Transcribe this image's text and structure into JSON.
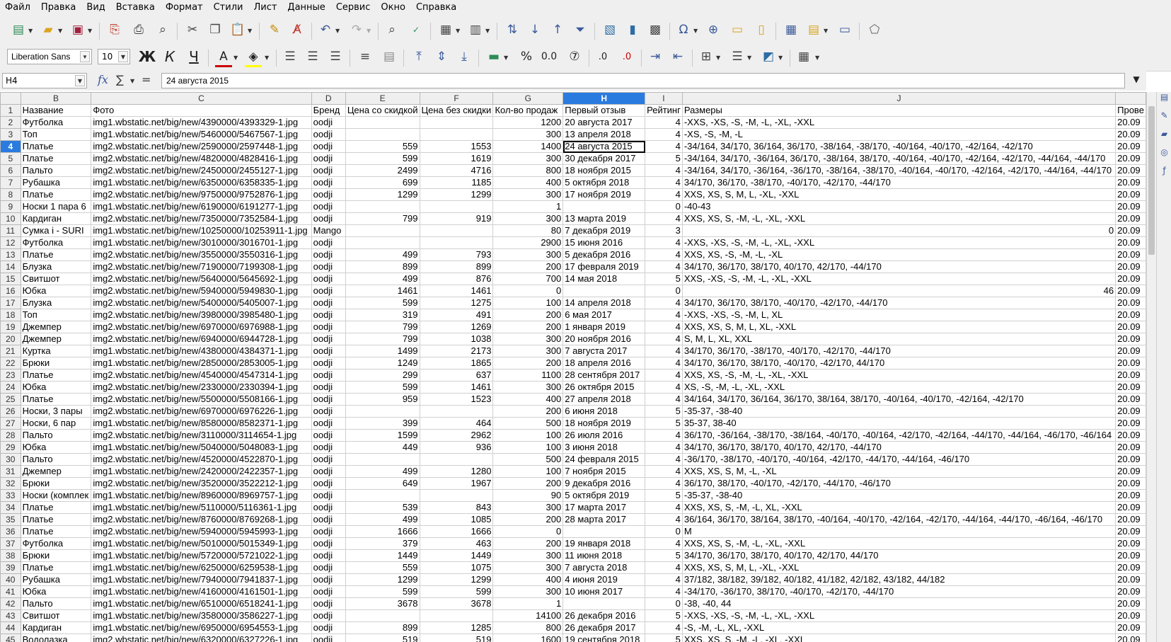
{
  "menu": [
    "Файл",
    "Правка",
    "Вид",
    "Вставка",
    "Формат",
    "Стили",
    "Лист",
    "Данные",
    "Сервис",
    "Окно",
    "Справка"
  ],
  "toolbar": {
    "font_name": "Liberation Sans",
    "font_size": "10",
    "bold": "Ж",
    "italic": "К",
    "underline": "Ч",
    "percent": "%",
    "decimal": "0.0",
    "add_decimal": ".0",
    "del_decimal": ".0"
  },
  "formula_bar": {
    "cell_ref": "H4",
    "fx": "fx",
    "sum": "∑",
    "eq": "=",
    "content": "24 августа 2015"
  },
  "columns": [
    "B",
    "C",
    "D",
    "E",
    "F",
    "G",
    "H",
    "I",
    "J"
  ],
  "selected_column": "H",
  "selected_row": 4,
  "header_row": [
    "Название",
    "Фото",
    "Бренд",
    "Цена со скидкой",
    "Цена без скидки",
    "Кол-во продаж",
    "Первый отзыв",
    "Рейтинг",
    "Размеры",
    "Прове"
  ],
  "rows": [
    [
      "Футболка",
      "img1.wbstatic.net/big/new/4390000/4393329-1.jpg",
      "oodji",
      "",
      "",
      "1200",
      "20 августа 2017",
      "4",
      "-XXS, -XS, -S, -M, -L, -XL, -XXL",
      "20.09"
    ],
    [
      "Топ",
      "img1.wbstatic.net/big/new/5460000/5467567-1.jpg",
      "oodji",
      "",
      "",
      "300",
      "13 апреля 2018",
      "4",
      "-XS, -S, -M, -L",
      "20.09"
    ],
    [
      "Платье",
      "img2.wbstatic.net/big/new/2590000/2597448-1.jpg",
      "oodji",
      "559",
      "1553",
      "1400",
      "24 августа 2015",
      "4",
      "-34/164, 34/170, 36/164, 36/170, -38/164, -38/170, -40/164, -40/170, -42/164, -42/170",
      "20.09"
    ],
    [
      "Платье",
      "img2.wbstatic.net/big/new/4820000/4828416-1.jpg",
      "oodji",
      "599",
      "1619",
      "300",
      "30 декабря 2017",
      "5",
      "-34/164, 34/170, -36/164, 36/170, -38/164, 38/170, -40/164, -40/170, -42/164, -42/170, -44/164, -44/170",
      "20.09"
    ],
    [
      "Пальто",
      "img2.wbstatic.net/big/new/2450000/2455127-1.jpg",
      "oodji",
      "2499",
      "4716",
      "800",
      "18 ноября 2015",
      "4",
      "-34/164, 34/170, -36/164, -36/170, -38/164, -38/170, -40/164, -40/170, -42/164, -42/170, -44/164, -44/170",
      "20.09"
    ],
    [
      "Рубашка",
      "img1.wbstatic.net/big/new/6350000/6358335-1.jpg",
      "oodji",
      "699",
      "1185",
      "400",
      "5 октября 2018",
      "4",
      "34/170, 36/170, -38/170, -40/170, -42/170, -44/170",
      "20.09"
    ],
    [
      "Платье",
      "img2.wbstatic.net/big/new/9750000/9752876-1.jpg",
      "oodji",
      "1299",
      "1299",
      "300",
      "17 ноября 2019",
      "4",
      "XXS, XS, S, M, L, -XL, -XXL",
      "20.09"
    ],
    [
      "Носки 1 пара 6",
      "img1.wbstatic.net/big/new/6190000/6191277-1.jpg",
      "oodji",
      "",
      "",
      "1",
      "",
      "0",
      "-40-43",
      "20.09"
    ],
    [
      "Кардиган",
      "img2.wbstatic.net/big/new/7350000/7352584-1.jpg",
      "oodji",
      "799",
      "919",
      "300",
      "13 марта 2019",
      "4",
      "XXS, XS, S, -M, -L, -XL, -XXL",
      "20.09"
    ],
    [
      "Сумка i - SURI",
      "img1.wbstatic.net/big/new/10250000/10253911-1.jpg",
      "Mango",
      "",
      "",
      "80",
      "7 декабря 2019",
      "3",
      "0",
      "20.09"
    ],
    [
      "Футболка",
      "img1.wbstatic.net/big/new/3010000/3016701-1.jpg",
      "oodji",
      "",
      "",
      "2900",
      "15 июня 2016",
      "4",
      "-XXS, -XS, -S, -M, -L, -XL, -XXL",
      "20.09"
    ],
    [
      "Платье",
      "img2.wbstatic.net/big/new/3550000/3550316-1.jpg",
      "oodji",
      "499",
      "793",
      "300",
      "5 декабря 2016",
      "4",
      "XXS, XS, -S, -M, -L, -XL",
      "20.09"
    ],
    [
      "Блузка",
      "img2.wbstatic.net/big/new/7190000/7199308-1.jpg",
      "oodji",
      "899",
      "899",
      "200",
      "17 февраля 2019",
      "4",
      "34/170, 36/170, 38/170, 40/170, 42/170, -44/170",
      "20.09"
    ],
    [
      "Свитшот",
      "img2.wbstatic.net/big/new/5640000/5645692-1.jpg",
      "oodji",
      "499",
      "876",
      "700",
      "14 мая 2018",
      "5",
      "XXS, -XS, -S, -M, -L, -XL, -XXL",
      "20.09"
    ],
    [
      "Юбка",
      "img2.wbstatic.net/big/new/5940000/5949830-1.jpg",
      "oodji",
      "1461",
      "1461",
      "0",
      "",
      "0",
      "46",
      "20.09"
    ],
    [
      "Блузка",
      "img2.wbstatic.net/big/new/5400000/5405007-1.jpg",
      "oodji",
      "599",
      "1275",
      "100",
      "14 апреля 2018",
      "4",
      "34/170, 36/170, 38/170, -40/170, -42/170, -44/170",
      "20.09"
    ],
    [
      "Топ",
      "img2.wbstatic.net/big/new/3980000/3985480-1.jpg",
      "oodji",
      "319",
      "491",
      "200",
      "6 мая 2017",
      "4",
      "-XXS, -XS, -S, -M, L, XL",
      "20.09"
    ],
    [
      "Джемпер",
      "img2.wbstatic.net/big/new/6970000/6976988-1.jpg",
      "oodji",
      "799",
      "1269",
      "200",
      "1 января 2019",
      "4",
      "XXS, XS, S, M, L, XL, -XXL",
      "20.09"
    ],
    [
      "Джемпер",
      "img2.wbstatic.net/big/new/6940000/6944728-1.jpg",
      "oodji",
      "799",
      "1038",
      "300",
      "20 ноября 2016",
      "4",
      "S, M, L, XL, XXL",
      "20.09"
    ],
    [
      "Куртка",
      "img1.wbstatic.net/big/new/4380000/4384371-1.jpg",
      "oodji",
      "1499",
      "2173",
      "300",
      "7 августа 2017",
      "4",
      "34/170, 36/170, -38/170, -40/170, -42/170, -44/170",
      "20.09"
    ],
    [
      "Брюки",
      "img1.wbstatic.net/big/new/2850000/2853005-1.jpg",
      "oodji",
      "1249",
      "1865",
      "200",
      "18 апреля 2016",
      "4",
      "34/170, 36/170, 38/170, -40/170, -42/170, 44/170",
      "20.09"
    ],
    [
      "Платье",
      "img2.wbstatic.net/big/new/4540000/4547314-1.jpg",
      "oodji",
      "299",
      "637",
      "1100",
      "28 сентября 2017",
      "4",
      "XXS, XS, -S, -M, -L, -XL, -XXL",
      "20.09"
    ],
    [
      "Юбка",
      "img2.wbstatic.net/big/new/2330000/2330394-1.jpg",
      "oodji",
      "599",
      "1461",
      "300",
      "26 октября 2015",
      "4",
      "XS, -S, -M, -L, -XL, -XXL",
      "20.09"
    ],
    [
      "Платье",
      "img2.wbstatic.net/big/new/5500000/5508166-1.jpg",
      "oodji",
      "959",
      "1523",
      "400",
      "27 апреля 2018",
      "4",
      "34/164, 34/170, 36/164, 36/170, 38/164, 38/170, -40/164, -40/170, -42/164, -42/170",
      "20.09"
    ],
    [
      "Носки, 3 пары",
      "img2.wbstatic.net/big/new/6970000/6976226-1.jpg",
      "oodji",
      "",
      "",
      "200",
      "6 июня 2018",
      "5",
      "-35-37, -38-40",
      "20.09"
    ],
    [
      "Носки, 6 пар",
      "img1.wbstatic.net/big/new/8580000/8582371-1.jpg",
      "oodji",
      "399",
      "464",
      "500",
      "18 ноября 2019",
      "5",
      "35-37, 38-40",
      "20.09"
    ],
    [
      "Пальто",
      "img2.wbstatic.net/big/new/3110000/3114654-1.jpg",
      "oodji",
      "1599",
      "2962",
      "100",
      "26 июля 2016",
      "4",
      "36/170, -36/164, -38/170, -38/164, -40/170, -40/164, -42/170, -42/164, -44/170, -44/164, -46/170, -46/164",
      "20.09"
    ],
    [
      "Юбка",
      "img1.wbstatic.net/big/new/5040000/5048083-1.jpg",
      "oodji",
      "449",
      "936",
      "100",
      "3 июня 2018",
      "4",
      "34/170, 36/170, 38/170, 40/170, 42/170, -44/170",
      "20.09"
    ],
    [
      "Пальто",
      "img2.wbstatic.net/big/new/4520000/4522870-1.jpg",
      "oodji",
      "",
      "",
      "500",
      "24 февраля 2015",
      "4",
      "-36/170, -38/170, -40/170, -40/164, -42/170, -44/170, -44/164, -46/170",
      "20.09"
    ],
    [
      "Джемпер",
      "img1.wbstatic.net/big/new/2420000/2422357-1.jpg",
      "oodji",
      "499",
      "1280",
      "100",
      "7 ноября 2015",
      "4",
      "XXS, XS, S, M, -L, -XL",
      "20.09"
    ],
    [
      "Брюки",
      "img2.wbstatic.net/big/new/3520000/3522212-1.jpg",
      "oodji",
      "649",
      "1967",
      "200",
      "9 декабря 2016",
      "4",
      "36/170, 38/170, -40/170, -42/170, -44/170, -46/170",
      "20.09"
    ],
    [
      "Носки (комплек",
      "img1.wbstatic.net/big/new/8960000/8969757-1.jpg",
      "oodji",
      "",
      "",
      "90",
      "5 октября 2019",
      "5",
      "-35-37, -38-40",
      "20.09"
    ],
    [
      "Платье",
      "img1.wbstatic.net/big/new/5110000/5116361-1.jpg",
      "oodji",
      "539",
      "843",
      "300",
      "17 марта 2017",
      "4",
      "XXS, XS, S, -M, -L, XL, -XXL",
      "20.09"
    ],
    [
      "Платье",
      "img2.wbstatic.net/big/new/8760000/8769268-1.jpg",
      "oodji",
      "499",
      "1085",
      "200",
      "28 марта 2017",
      "4",
      "36/164, 36/170, 38/164, 38/170, -40/164, -40/170, -42/164, -42/170, -44/164, -44/170, -46/164, -46/170",
      "20.09"
    ],
    [
      "Платье",
      "img2.wbstatic.net/big/new/5940000/5945993-1.jpg",
      "oodji",
      "1666",
      "1666",
      "0",
      "",
      "0",
      "M",
      "20.09"
    ],
    [
      "Футболка",
      "img1.wbstatic.net/big/new/5010000/5015349-1.jpg",
      "oodji",
      "379",
      "463",
      "200",
      "19 января 2018",
      "4",
      "XXS, XS, S, -M, -L, -XL, -XXL",
      "20.09"
    ],
    [
      "Брюки",
      "img1.wbstatic.net/big/new/5720000/5721022-1.jpg",
      "oodji",
      "1449",
      "1449",
      "300",
      "11 июня 2018",
      "5",
      "34/170, 36/170, 38/170, 40/170, 42/170, 44/170",
      "20.09"
    ],
    [
      "Платье",
      "img1.wbstatic.net/big/new/6250000/6259538-1.jpg",
      "oodji",
      "559",
      "1075",
      "300",
      "7 августа 2018",
      "4",
      "XXS, XS, S, M, L, -XL, -XXL",
      "20.09"
    ],
    [
      "Рубашка",
      "img1.wbstatic.net/big/new/7940000/7941837-1.jpg",
      "oodji",
      "1299",
      "1299",
      "400",
      "4 июня 2019",
      "4",
      "37/182, 38/182, 39/182, 40/182, 41/182, 42/182, 43/182, 44/182",
      "20.09"
    ],
    [
      "Юбка",
      "img1.wbstatic.net/big/new/4160000/4161501-1.jpg",
      "oodji",
      "599",
      "599",
      "300",
      "10 июня 2017",
      "4",
      "-34/170, -36/170, 38/170, -40/170, -42/170, -44/170",
      "20.09"
    ],
    [
      "Пальто",
      "img1.wbstatic.net/big/new/6510000/6518241-1.jpg",
      "oodji",
      "3678",
      "3678",
      "1",
      "",
      "0",
      "-38, -40, 44",
      "20.09"
    ],
    [
      "Свитшот",
      "img1.wbstatic.net/big/new/3580000/3586227-1.jpg",
      "oodji",
      "",
      "",
      "14100",
      "26 декабря 2016",
      "5",
      "-XXS, -XS, -S, -M, -L, -XL, -XXL",
      "20.09"
    ],
    [
      "Кардиган",
      "img1.wbstatic.net/big/new/6950000/6954553-1.jpg",
      "oodji",
      "899",
      "1285",
      "800",
      "26 декабря 2017",
      "4",
      "-S, -M, -L, XL, -XXL",
      "20.09"
    ],
    [
      "Водолазка",
      "img2.wbstatic.net/big/new/6320000/6327226-1.jpg",
      "oodji",
      "519",
      "519",
      "1600",
      "19 сентября 2018",
      "5",
      "XXS, XS, S, -M, -L, -XL, -XXL",
      "20.09"
    ]
  ]
}
